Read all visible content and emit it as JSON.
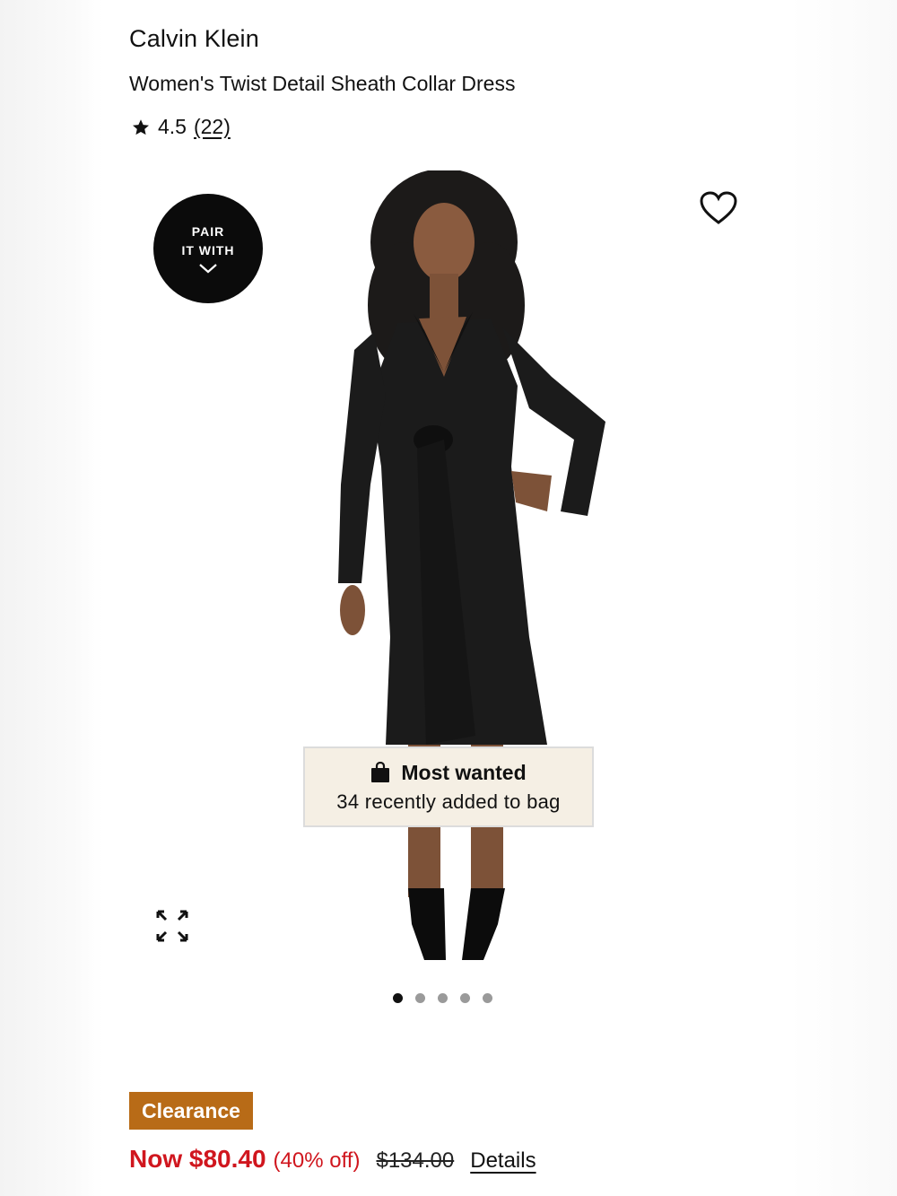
{
  "product": {
    "brand": "Calvin Klein",
    "name": "Women's Twist Detail Sheath Collar Dress",
    "rating": "4.5",
    "review_count": "(22)"
  },
  "gallery": {
    "pair_badge_line1": "PAIR",
    "pair_badge_line2": "IT WITH",
    "total_images": 5,
    "active_index": 0,
    "icons": [
      "star-icon",
      "heart-icon",
      "expand-icon",
      "chevron-down-icon",
      "shopping-bag-icon"
    ]
  },
  "social_proof": {
    "title": "Most wanted",
    "subtitle": "34 recently added to bag"
  },
  "pricing": {
    "badge": "Clearance",
    "now_price": "Now $80.40",
    "discount": "(40% off)",
    "original_price": "$134.00",
    "details_link": "Details"
  },
  "colors": {
    "sale_red": "#d0161e",
    "clearance_brown": "#b86b17",
    "badge_black": "#0b0b0b",
    "most_wanted_bg": "#f5efe4"
  }
}
